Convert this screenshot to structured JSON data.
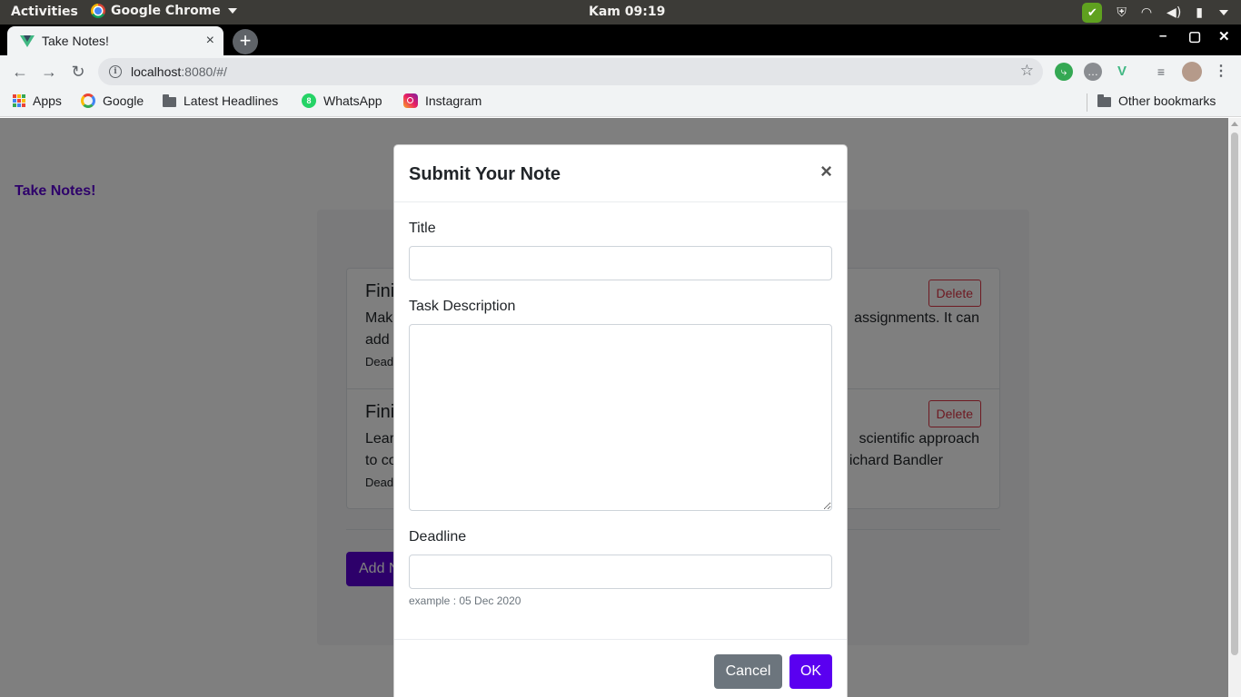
{
  "system_bar": {
    "activities": "Activities",
    "app_name": "Google Chrome",
    "clock": "Kam 09:19",
    "tray_icons": [
      "check-icon",
      "shield-icon",
      "wifi-icon",
      "volume-icon",
      "battery-icon",
      "power-menu-icon"
    ]
  },
  "browser": {
    "tab_title": "Take Notes!",
    "tab_close": "×",
    "new_tab": "+",
    "window_controls": [
      "–",
      "▢",
      "✕"
    ],
    "url_host": "localhost",
    "url_rest": ":8080/#/",
    "nav": {
      "back": "←",
      "forward": "→",
      "reload": "↻"
    },
    "extensions": [
      "share-extension-icon",
      "chat-extension-icon",
      "vue-devtools-icon",
      "media-queue-icon",
      "profile-avatar"
    ]
  },
  "bookmarks": {
    "items": [
      {
        "label": "Apps",
        "icon": "apps-icon"
      },
      {
        "label": "Google",
        "icon": "google-icon"
      },
      {
        "label": "Latest Headlines",
        "icon": "folder-icon"
      },
      {
        "label": "WhatsApp",
        "icon": "whatsapp-icon"
      },
      {
        "label": "Instagram",
        "icon": "instagram-icon"
      }
    ],
    "other": "Other bookmarks"
  },
  "page": {
    "brand": "Take Notes!",
    "notes": [
      {
        "title": "Fini",
        "desc_left": "Make",
        "desc_left2": "add",
        "desc_right": "assignments. It can",
        "desc_right2": "",
        "deadline": "Dead",
        "delete": "Delete"
      },
      {
        "title": "Fini",
        "desc_left": "Lear",
        "desc_left2": "to co",
        "desc_right": "scientific approach",
        "desc_right2": "ichard Bandler",
        "deadline": "Dead",
        "delete": "Delete"
      }
    ],
    "add_button": "Add N"
  },
  "modal": {
    "title": "Submit Your Note",
    "close": "×",
    "title_label": "Title",
    "title_value": "",
    "description_label": "Task Description",
    "description_value": "",
    "deadline_label": "Deadline",
    "deadline_value": "",
    "deadline_help": "example : 05 Dec 2020",
    "cancel": "Cancel",
    "ok": "OK"
  },
  "colors": {
    "brand": "#5a00d4",
    "ok_button": "#5a00f0",
    "cancel_button": "#6c757d",
    "delete": "#dc3545"
  }
}
